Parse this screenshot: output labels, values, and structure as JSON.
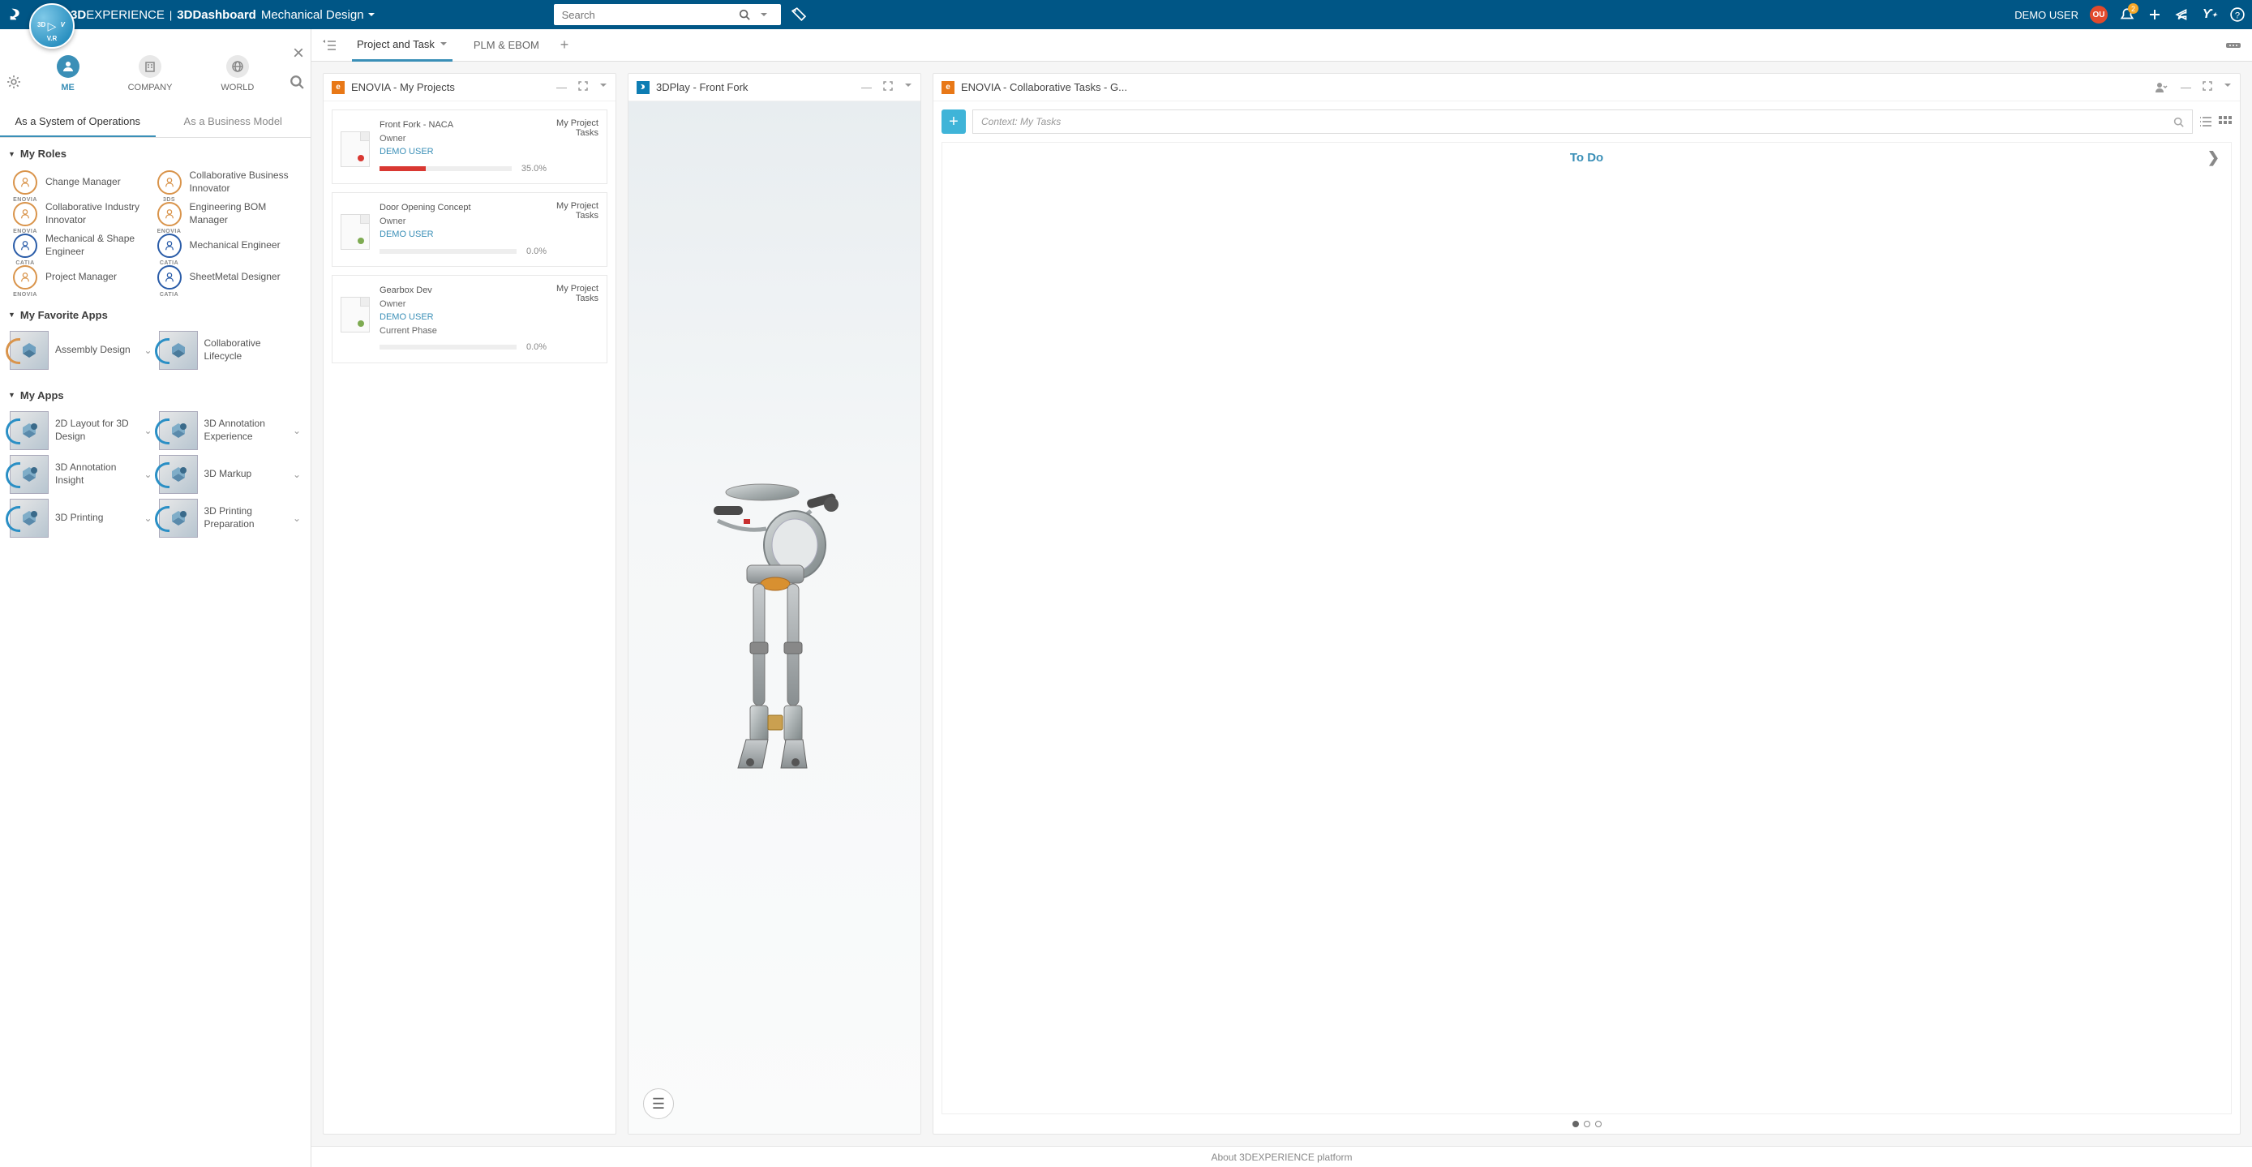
{
  "topbar": {
    "brand_exp": "EXPERIENCE",
    "brand_app": "3DDashboard",
    "dashboard_name": "Mechanical Design",
    "search_placeholder": "Search",
    "user": "DEMO USER",
    "avatar_initials": "OU",
    "notif_count": "2"
  },
  "sidebar": {
    "scopes": [
      {
        "id": "me",
        "label": "ME"
      },
      {
        "id": "company",
        "label": "COMPANY"
      },
      {
        "id": "world",
        "label": "WORLD"
      }
    ],
    "subtabs": {
      "ops": "As a System of Operations",
      "biz": "As a Business Model"
    },
    "sections": {
      "roles": "My Roles",
      "fav_apps": "My Favorite Apps",
      "my_apps": "My Apps"
    },
    "roles": [
      {
        "label": "Change Manager",
        "brand": "ENOVIA",
        "cls": ""
      },
      {
        "label": "Collaborative Business Innovator",
        "brand": "3DS",
        "cls": ""
      },
      {
        "label": "Collaborative Industry Innovator",
        "brand": "ENOVIA",
        "cls": ""
      },
      {
        "label": "Engineering BOM Manager",
        "brand": "ENOVIA",
        "cls": ""
      },
      {
        "label": "Mechanical & Shape Engineer",
        "brand": "CATIA",
        "cls": "catia"
      },
      {
        "label": "Mechanical Engineer",
        "brand": "CATIA",
        "cls": "catia"
      },
      {
        "label": "Project Manager",
        "brand": "ENOVIA",
        "cls": ""
      },
      {
        "label": "SheetMetal Designer",
        "brand": "CATIA",
        "cls": "catia"
      }
    ],
    "fav_apps": [
      {
        "label": "Assembly Design"
      },
      {
        "label": "Collaborative Lifecycle"
      }
    ],
    "apps": [
      {
        "label": "2D Layout for 3D Design"
      },
      {
        "label": "3D Annotation Experience"
      },
      {
        "label": "3D Annotation Insight"
      },
      {
        "label": "3D Markup"
      },
      {
        "label": "3D Printing"
      },
      {
        "label": "3D Printing Preparation"
      }
    ]
  },
  "tabbar": {
    "tab1": "Project and Task",
    "tab2": "PLM & EBOM"
  },
  "w_projects": {
    "title": "ENOVIA - My Projects",
    "link_text": "My Project Tasks",
    "owner_label": "Owner",
    "phase_label": "Current Phase",
    "items": [
      {
        "name": "Front Fork - NACA",
        "owner": "DEMO USER",
        "progress_fill": 35,
        "progress_text": "35.0%",
        "dot": "#d93832"
      },
      {
        "name": "Door Opening Concept",
        "owner": "DEMO USER",
        "progress_fill": 0,
        "progress_text": "0.0%",
        "dot": "#7eab52"
      },
      {
        "name": "Gearbox Dev",
        "owner": "DEMO USER",
        "show_phase": true,
        "progress_fill": 0,
        "progress_text": "0.0%",
        "dot": "#7eab52"
      }
    ]
  },
  "w_3dplay": {
    "title": "3DPlay - Front Fork"
  },
  "w_tasks": {
    "title": "ENOVIA - Collaborative Tasks - G...",
    "ctx_placeholder": "Context: My Tasks",
    "todo": "To Do"
  },
  "footer": {
    "text": "About 3DEXPERIENCE platform"
  }
}
